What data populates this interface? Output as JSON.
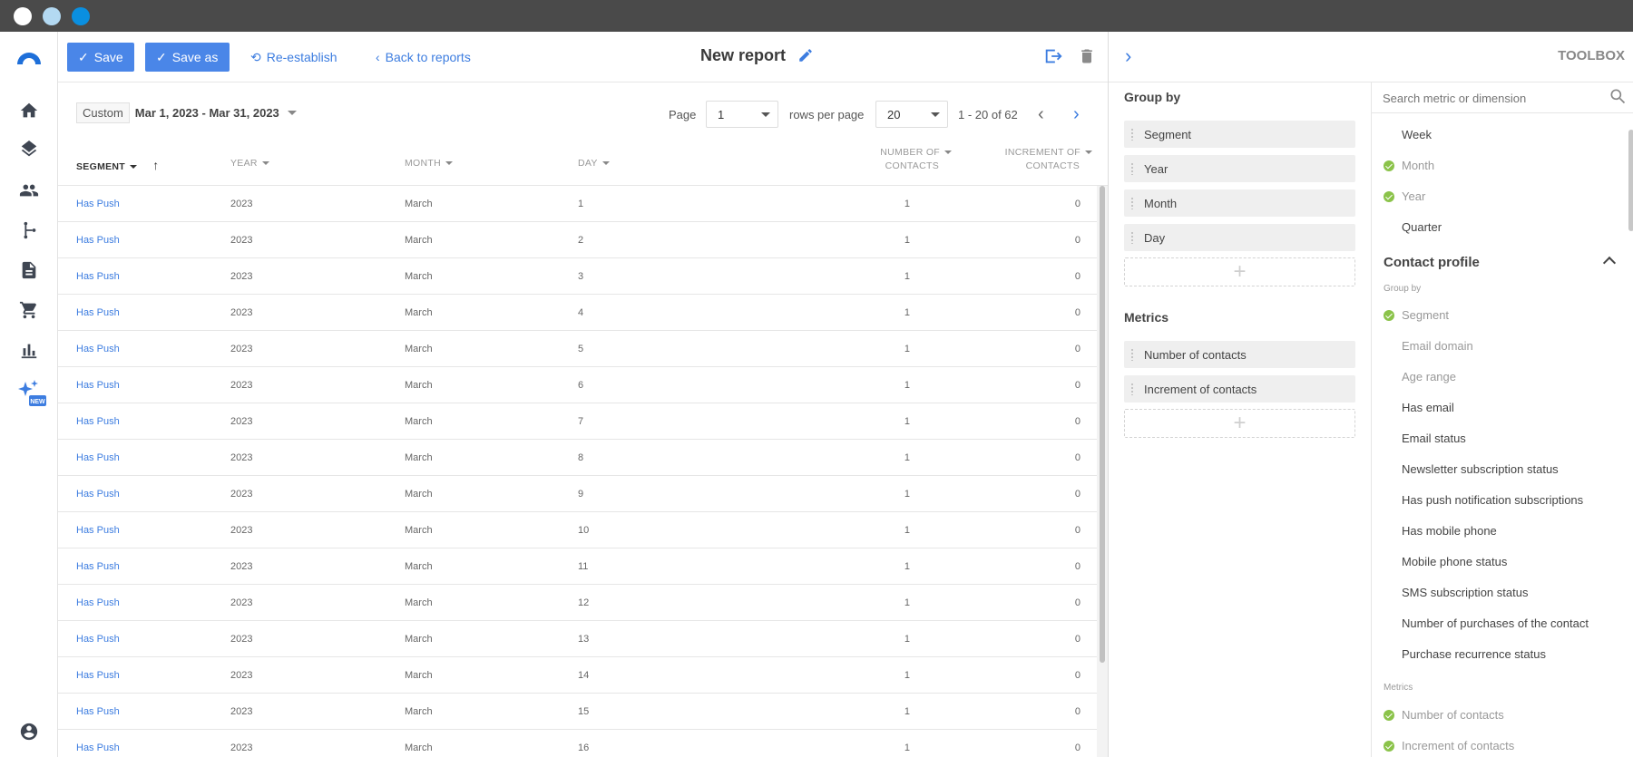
{
  "colors": {
    "accent": "#4a86e8",
    "link": "#3d7de0",
    "check": "#8bc34a",
    "titlebar": "#4a4a4a"
  },
  "window_dots": [
    "#ffffff",
    "#b3d9f2",
    "#0a8fe0"
  ],
  "sidebar": {
    "items": [
      "logo-icon",
      "home-icon",
      "layers-icon",
      "contacts-icon",
      "flow-icon",
      "document-icon",
      "cart-icon",
      "bar-chart-icon",
      "sparkle-new-icon"
    ],
    "new_badge": "NEW",
    "bottom": "account-icon"
  },
  "header": {
    "save_label": "Save",
    "save_as_label": "Save as",
    "reestablish_label": "Re-establish",
    "back_label": "Back to reports",
    "title": "New report"
  },
  "filter": {
    "custom": "Custom",
    "range": "Mar 1, 2023 - Mar 31, 2023"
  },
  "pager": {
    "page_label": "Page",
    "page_value": "1",
    "rows_label": "rows per page",
    "rows_value": "20",
    "count": "1 - 20 of 62"
  },
  "table": {
    "headers": {
      "segment": "SEGMENT",
      "year": "YEAR",
      "month": "MONTH",
      "day": "DAY",
      "contacts_1": "NUMBER OF",
      "contacts_2": "CONTACTS",
      "increment_1": "INCREMENT OF",
      "increment_2": "CONTACTS"
    },
    "rows": [
      {
        "segment": "Has Push",
        "year": "2023",
        "month": "March",
        "day": "1",
        "contacts": "1",
        "increment": "0"
      },
      {
        "segment": "Has Push",
        "year": "2023",
        "month": "March",
        "day": "2",
        "contacts": "1",
        "increment": "0"
      },
      {
        "segment": "Has Push",
        "year": "2023",
        "month": "March",
        "day": "3",
        "contacts": "1",
        "increment": "0"
      },
      {
        "segment": "Has Push",
        "year": "2023",
        "month": "March",
        "day": "4",
        "contacts": "1",
        "increment": "0"
      },
      {
        "segment": "Has Push",
        "year": "2023",
        "month": "March",
        "day": "5",
        "contacts": "1",
        "increment": "0"
      },
      {
        "segment": "Has Push",
        "year": "2023",
        "month": "March",
        "day": "6",
        "contacts": "1",
        "increment": "0"
      },
      {
        "segment": "Has Push",
        "year": "2023",
        "month": "March",
        "day": "7",
        "contacts": "1",
        "increment": "0"
      },
      {
        "segment": "Has Push",
        "year": "2023",
        "month": "March",
        "day": "8",
        "contacts": "1",
        "increment": "0"
      },
      {
        "segment": "Has Push",
        "year": "2023",
        "month": "March",
        "day": "9",
        "contacts": "1",
        "increment": "0"
      },
      {
        "segment": "Has Push",
        "year": "2023",
        "month": "March",
        "day": "10",
        "contacts": "1",
        "increment": "0"
      },
      {
        "segment": "Has Push",
        "year": "2023",
        "month": "March",
        "day": "11",
        "contacts": "1",
        "increment": "0"
      },
      {
        "segment": "Has Push",
        "year": "2023",
        "month": "March",
        "day": "12",
        "contacts": "1",
        "increment": "0"
      },
      {
        "segment": "Has Push",
        "year": "2023",
        "month": "March",
        "day": "13",
        "contacts": "1",
        "increment": "0"
      },
      {
        "segment": "Has Push",
        "year": "2023",
        "month": "March",
        "day": "14",
        "contacts": "1",
        "increment": "0"
      },
      {
        "segment": "Has Push",
        "year": "2023",
        "month": "March",
        "day": "15",
        "contacts": "1",
        "increment": "0"
      },
      {
        "segment": "Has Push",
        "year": "2023",
        "month": "March",
        "day": "16",
        "contacts": "1",
        "increment": "0"
      }
    ]
  },
  "toolbox": {
    "title": "TOOLBOX",
    "group_by_title": "Group by",
    "group_by": [
      "Segment",
      "Year",
      "Month",
      "Day"
    ],
    "metrics_title": "Metrics",
    "metrics": [
      "Number of contacts",
      "Increment of contacts"
    ],
    "search_placeholder": "Search metric or dimension",
    "time_items": [
      {
        "label": "Week",
        "checked": false
      },
      {
        "label": "Month",
        "checked": true
      },
      {
        "label": "Year",
        "checked": true
      },
      {
        "label": "Quarter",
        "checked": false
      }
    ],
    "contact_profile_title": "Contact profile",
    "group_by_small": "Group by",
    "profile_items": [
      {
        "label": "Segment",
        "checked": true,
        "muted": true
      },
      {
        "label": "Email domain",
        "checked": false,
        "muted": true
      },
      {
        "label": "Age range",
        "checked": false,
        "muted": true
      },
      {
        "label": "Has email",
        "checked": false,
        "muted": false
      },
      {
        "label": "Email status",
        "checked": false,
        "muted": false
      },
      {
        "label": "Newsletter subscription status",
        "checked": false,
        "muted": false
      },
      {
        "label": "Has push notification subscriptions",
        "checked": false,
        "muted": false
      },
      {
        "label": "Has mobile phone",
        "checked": false,
        "muted": false
      },
      {
        "label": "Mobile phone status",
        "checked": false,
        "muted": false
      },
      {
        "label": "SMS subscription status",
        "checked": false,
        "muted": false
      },
      {
        "label": "Number of purchases of the contact",
        "checked": false,
        "muted": false
      },
      {
        "label": "Purchase recurrence status",
        "checked": false,
        "muted": false
      }
    ],
    "metrics_small": "Metrics",
    "metric_items": [
      {
        "label": "Number of contacts",
        "checked": true
      },
      {
        "label": "Increment of contacts",
        "checked": true
      }
    ]
  }
}
